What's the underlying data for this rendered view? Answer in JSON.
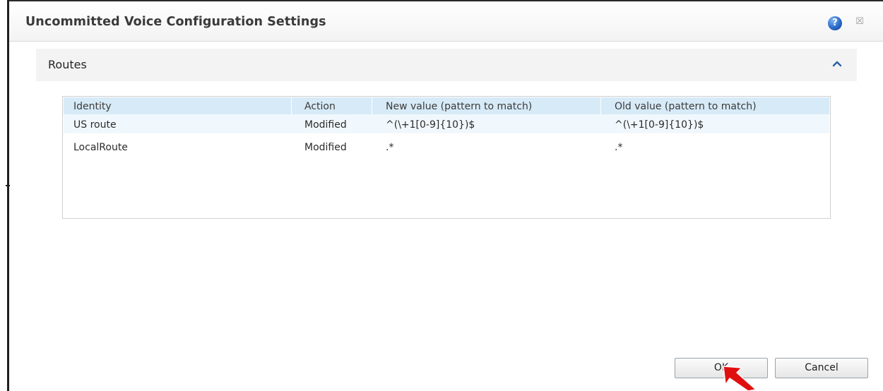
{
  "window": {
    "title": "Uncommitted Voice Configuration Settings",
    "help_glyph": "?",
    "close_glyph": "☒"
  },
  "section": {
    "title": "Routes",
    "expanded": true
  },
  "table": {
    "columns": [
      "Identity",
      "Action",
      "New value (pattern to match)",
      "Old value (pattern to match)"
    ],
    "rows": [
      [
        "US route",
        "Modified",
        "^(\\+1[0-9]{10})$",
        "^(\\+1[0-9]{10})$"
      ],
      [
        "LocalRoute",
        "Modified",
        ".*",
        ".*"
      ]
    ]
  },
  "buttons": {
    "ok": "OK",
    "cancel": "Cancel"
  },
  "colors": {
    "header_row": "#d7eaf7",
    "alt_row": "#f1f8fd",
    "annotation_arrow": "#e01010"
  },
  "icons": {
    "help": "help-icon",
    "close": "close-icon",
    "collapse": "chevron-up-icon",
    "annotation": "red-arrow-icon"
  }
}
